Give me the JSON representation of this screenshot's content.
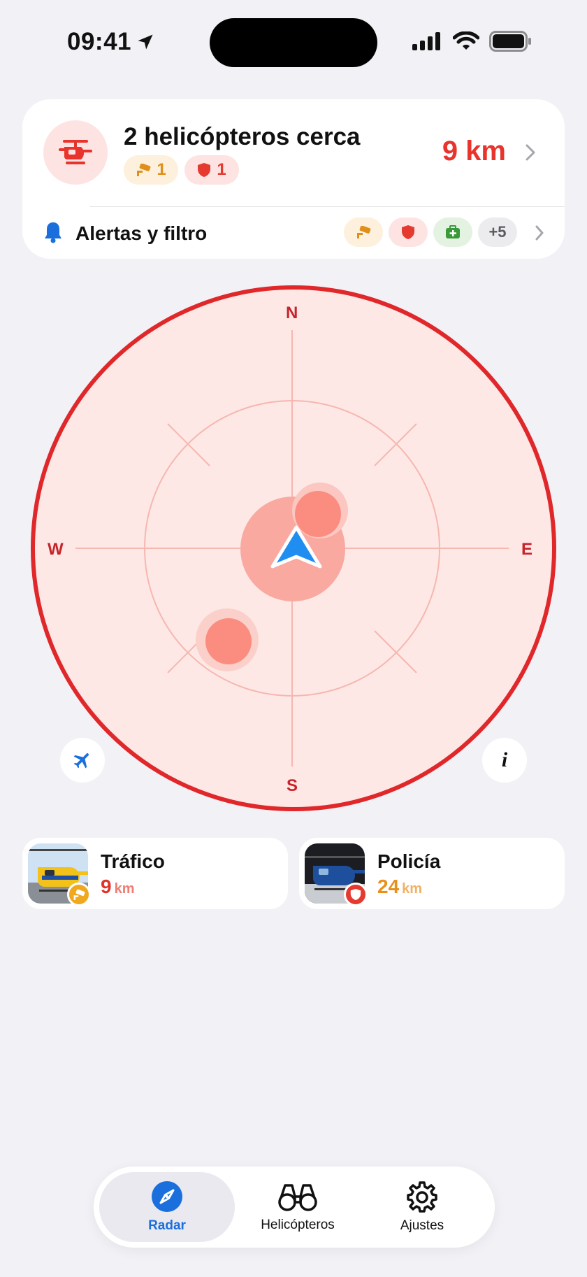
{
  "status_bar": {
    "time": "09:41"
  },
  "summary": {
    "title": "2 helicópteros cerca",
    "traffic_count": "1",
    "police_count": "1",
    "distance": "9 km"
  },
  "alerts": {
    "label": "Alertas y filtro",
    "more_count": "+5"
  },
  "compass": {
    "north": "N",
    "south": "S",
    "west": "W",
    "east": "E"
  },
  "radar": {
    "info_label": "i"
  },
  "helicopters": [
    {
      "name": "Tráfico",
      "distance": "9",
      "unit": "km",
      "color": "#e0332b",
      "badge": "traffic"
    },
    {
      "name": "Policía",
      "distance": "24",
      "unit": "km",
      "color": "#e8901c",
      "badge": "police"
    }
  ],
  "tabs": [
    {
      "label": "Radar",
      "icon": "compass-icon",
      "active": true
    },
    {
      "label": "Helicópteros",
      "icon": "binoculars-icon",
      "active": false
    },
    {
      "label": "Ajustes",
      "icon": "gear-icon",
      "active": false
    }
  ],
  "colors": {
    "accent_red": "#e8342c",
    "radar_fill": "#fde8e6",
    "radar_border": "#e0272a",
    "traffic": "#e0901a",
    "police": "#e43a30",
    "medical": "#3a9a3a",
    "tab_active": "#1a6fdc"
  }
}
